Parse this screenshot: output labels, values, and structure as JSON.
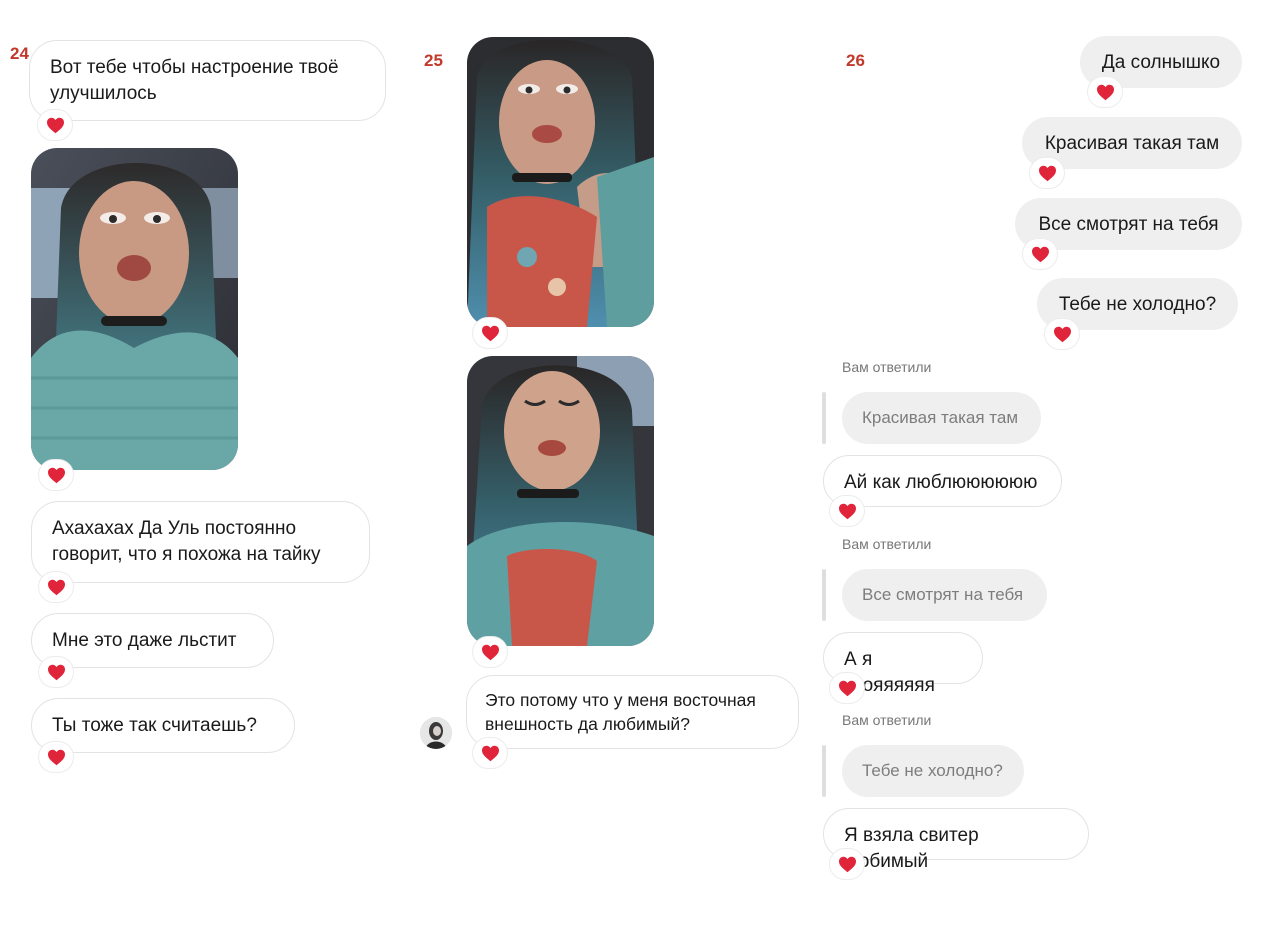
{
  "colors": {
    "number": "#c0392b",
    "outgoing_bubble": "#efefef",
    "incoming_border": "#e3e3e3",
    "heart": "#e0243a"
  },
  "reaction_icon": "heart-icon",
  "panel24": {
    "number": "24",
    "msg1": "Вот тебе чтобы настроение твоё улучшилось",
    "msg2": "Ахахахах Да Уль постоянно говорит, что я похожа на тайку",
    "msg3": "Мне это даже льстит",
    "msg4": "Ты тоже так считаешь?"
  },
  "panel25": {
    "number": "25",
    "msg1": "Это потому что у меня восточная внешность да любимый?"
  },
  "panel26": {
    "number": "26",
    "out1": "Да солнышко",
    "out2": "Красивая такая там",
    "out3": "Все смотрят на тебя",
    "out4": "Тебе не холодно?",
    "replied_label": "Вам ответили",
    "quote1": "Красивая такая там",
    "reply1": "Ай как люблюююююю",
    "quote2": "Все смотрят на тебя",
    "reply2": "А я твояяяяяя",
    "quote3": "Тебе не холодно?",
    "reply3": "Я взяла свитер любимый"
  }
}
